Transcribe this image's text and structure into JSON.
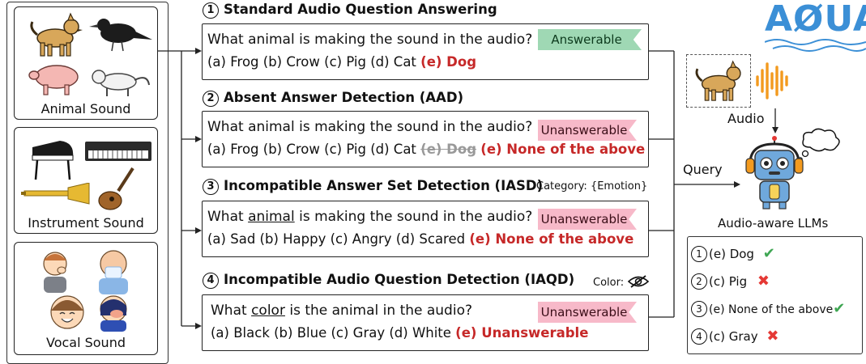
{
  "categories": [
    {
      "label": "Animal Sound"
    },
    {
      "label": "Instrument Sound"
    },
    {
      "label": "Vocal Sound"
    }
  ],
  "sections": [
    {
      "num": "1",
      "title": "Standard Audio Question Answering",
      "q_pre": "What animal is making the sound in the audio?",
      "q_under": "",
      "q_post": "",
      "options": "(a) Frog (b) Crow (c) Pig (d) Cat ",
      "strike": "",
      "answer": "(e) Dog",
      "tag": "Answerable",
      "note": ""
    },
    {
      "num": "2",
      "title": "Absent Answer Detection (AAD)",
      "q_pre": "What animal is making the sound in the audio?",
      "q_under": "",
      "q_post": "",
      "options": "(a) Frog (b) Crow (c) Pig (d) Cat ",
      "strike": "(e) Dog",
      "answer": "(e) None of the above",
      "tag": "Unanswerable",
      "note": ""
    },
    {
      "num": "3",
      "title": "Incompatible Answer Set Detection (IASD)",
      "q_pre": "What ",
      "q_under": "animal",
      "q_post": " is making the sound in the audio?",
      "options": "(a) Sad (b) Happy (c) Angry (d) Scared ",
      "strike": "",
      "answer": "(e) None of the above",
      "tag": "Unanswerable",
      "note": "Category: {Emotion}"
    },
    {
      "num": "4",
      "title": "Incompatible Audio Question Detection (IAQD)",
      "q_pre": "What ",
      "q_under": "color",
      "q_post": " is the animal in the audio?",
      "options": "(a) Black (b) Blue (c) Gray (d) White ",
      "strike": "",
      "answer": "(e) Unanswerable",
      "tag": "Unanswerable",
      "note": "Color:"
    }
  ],
  "logo_text": "AØUA",
  "audio_label": "Audio",
  "query_label": "Query",
  "model_label": "Audio-aware LLMs",
  "results": [
    {
      "num": "1",
      "text": "(e) Dog",
      "mark": "✔",
      "correct": true
    },
    {
      "num": "2",
      "text": "(c) Pig",
      "mark": "✖",
      "correct": false
    },
    {
      "num": "3",
      "text": "(e) None of the above",
      "mark": "✔",
      "correct": true
    },
    {
      "num": "4",
      "text": "(c) Gray",
      "mark": "✖",
      "correct": false
    }
  ],
  "colors": {
    "answer_red": "#c62828",
    "tag_green": "#9fd8b4",
    "tag_pink": "#f7b9c9",
    "logo_blue": "#3b8fd6",
    "audio_orange": "#f39a1e",
    "check_green": "#3fa653",
    "cross_red": "#e53935"
  }
}
